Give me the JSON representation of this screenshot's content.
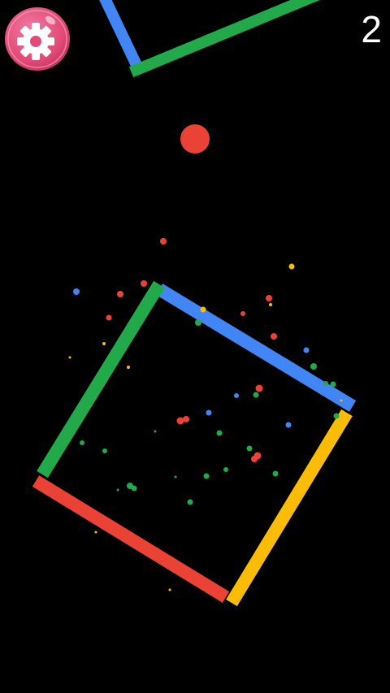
{
  "game": {
    "score": "2"
  },
  "settings_button": {
    "icon": "gear-icon",
    "color": "#e74c7a"
  },
  "colors": {
    "green": "#22a94a",
    "blue": "#4285f4",
    "red": "#ea4335",
    "yellow": "#fbbc05",
    "background": "#000000"
  }
}
